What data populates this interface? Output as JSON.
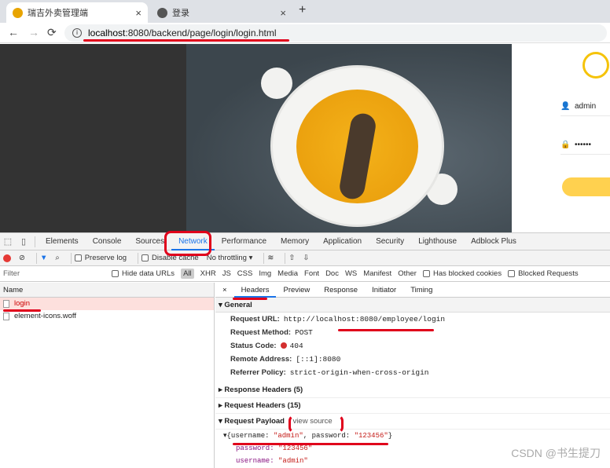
{
  "browser": {
    "tabs": [
      {
        "title": "瑞吉外卖管理端",
        "close": "×",
        "favicon_color": "#e8a400"
      },
      {
        "title": "登录",
        "close": "×",
        "favicon_color": "#555555"
      }
    ],
    "new_tab": "+",
    "back": "←",
    "forward": "→",
    "reload": "⟳",
    "info_icon": "i",
    "url_host": "localhost",
    "url_rest": ":8080/backend/page/login/login.html"
  },
  "login_page": {
    "username_value": "admin",
    "password_value": "••••••",
    "user_icon": "👤",
    "lock_icon": "🔒"
  },
  "devtools": {
    "tabs": [
      "Elements",
      "Console",
      "Sources",
      "Network",
      "Performance",
      "Memory",
      "Application",
      "Security",
      "Lighthouse",
      "Adblock Plus"
    ],
    "selected_tab": "Network",
    "toolbar": {
      "preserve_log": "Preserve log",
      "disable_cache": "Disable cache",
      "throttling": "No throttling"
    },
    "filter": {
      "placeholder": "Filter",
      "hide_data_urls": "Hide data URLs",
      "types": [
        "All",
        "XHR",
        "JS",
        "CSS",
        "Img",
        "Media",
        "Font",
        "Doc",
        "WS",
        "Manifest",
        "Other"
      ],
      "has_blocked_cookies": "Has blocked cookies",
      "blocked_requests": "Blocked Requests"
    },
    "requests": {
      "column": "Name",
      "items": [
        "login",
        "element-icons.woff"
      ]
    },
    "detail_tabs": [
      "Headers",
      "Preview",
      "Response",
      "Initiator",
      "Timing"
    ],
    "close": "×",
    "general": {
      "title": "General",
      "request_url_label": "Request URL:",
      "request_url": "http://localhost:8080/employee/login",
      "method_label": "Request Method:",
      "method": "POST",
      "status_label": "Status Code:",
      "status": "404",
      "remote_label": "Remote Address:",
      "remote": "[::1]:8080",
      "referrer_label": "Referrer Policy:",
      "referrer": "strict-origin-when-cross-origin"
    },
    "response_headers": "Response Headers (5)",
    "request_headers": "Request Headers (15)",
    "payload": {
      "title": "Request Payload",
      "view_source": "view source",
      "summary_open": "{username: ",
      "summary_user": "\"admin\"",
      "summary_mid": ", password: ",
      "summary_pass": "\"123456\"",
      "summary_close": "}",
      "password_key": "password:",
      "password_val": "\"123456\"",
      "username_key": "username:",
      "username_val": "\"admin\""
    }
  },
  "watermark": "CSDN @书生提刀"
}
